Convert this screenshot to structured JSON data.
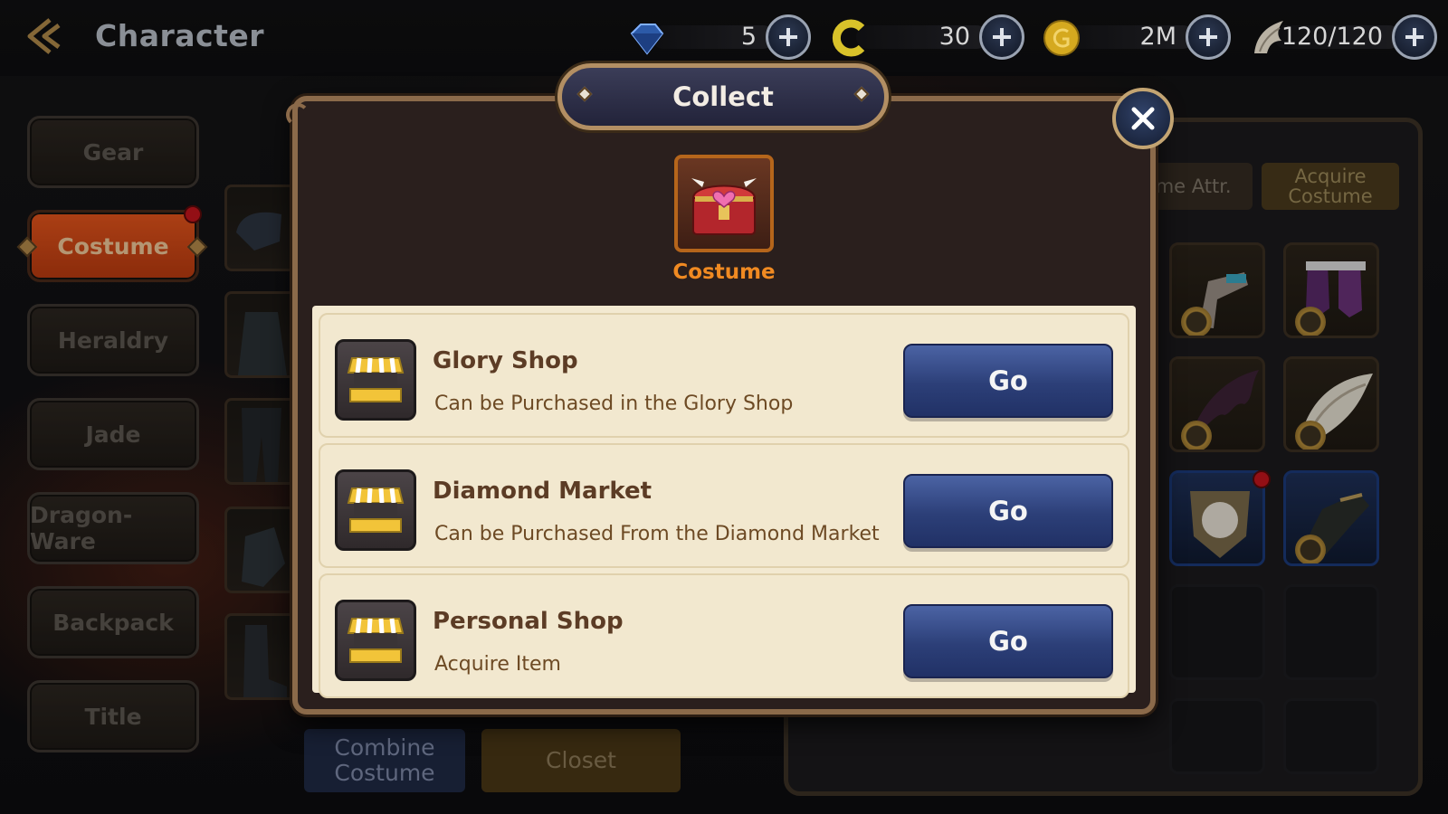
{
  "header": {
    "title": "Character",
    "resources": [
      {
        "icon": "diamond-icon",
        "value": "5"
      },
      {
        "icon": "glory-coin-icon",
        "value": "30"
      },
      {
        "icon": "gold-coin-icon",
        "value": "2M"
      },
      {
        "icon": "stamina-wing-icon",
        "value": "120/120"
      }
    ]
  },
  "nav": {
    "items": [
      {
        "label": "Gear"
      },
      {
        "label": "Costume"
      },
      {
        "label": "Heraldry"
      },
      {
        "label": "Jade"
      },
      {
        "label": "Dragon-Ware"
      },
      {
        "label": "Backpack"
      },
      {
        "label": "Title"
      }
    ],
    "active": "Costume"
  },
  "right_panel": {
    "tab_attr": "ume Attr.",
    "tab_acquire": "Acquire\nCostume"
  },
  "bottom": {
    "combine": "Combine\nCostume",
    "closet": "Closet"
  },
  "modal": {
    "title": "Collect",
    "item_label": "Costume",
    "sources": [
      {
        "title": "Glory Shop",
        "desc": "Can be Purchased in the Glory Shop",
        "button": "Go",
        "icon": "shop-stall-icon"
      },
      {
        "title": "Diamond Market",
        "desc": "Can be Purchased From the Diamond Market",
        "button": "Go",
        "icon": "shop-stall-icon"
      },
      {
        "title": "Personal Shop",
        "desc": "Acquire Item",
        "button": "Go",
        "icon": "shop-stall-icon"
      }
    ]
  },
  "colors": {
    "accent_orange": "#e5551c",
    "button_blue": "#2c3f78",
    "modal_frame": "#8b6a4a",
    "list_bg": "#f3e9d1"
  }
}
